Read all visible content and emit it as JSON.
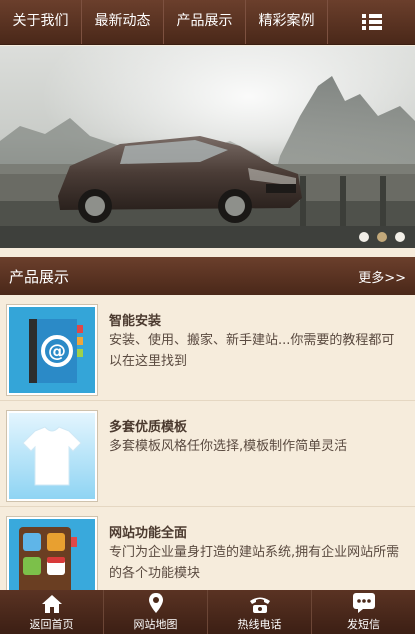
{
  "nav": {
    "items": [
      "关于我们",
      "最新动态",
      "产品展示",
      "精彩案例"
    ],
    "menu_icon": "grid-list-icon"
  },
  "banner": {
    "subject": "car-on-mountain-road",
    "dots": 3,
    "active_dot": 1
  },
  "section": {
    "title": "产品展示",
    "more": "更多>>"
  },
  "products": [
    {
      "title": "智能安装",
      "desc": "安装、使用、搬家、新手建站...你需要的教程都可以在这里找到",
      "icon": "address-book-icon"
    },
    {
      "title": "多套优质模板",
      "desc": "多套模板风格任你选择,模板制作简单灵活",
      "icon": "tshirt-icon"
    },
    {
      "title": "网站功能全面",
      "desc": "专门为企业量身打造的建站系统,拥有企业网站所需的各个功能模块",
      "icon": "app-grid-icon"
    }
  ],
  "bottom": [
    {
      "label": "返回首页",
      "icon": "home-icon"
    },
    {
      "label": "网站地图",
      "icon": "map-pin-icon"
    },
    {
      "label": "热线电话",
      "icon": "phone-icon"
    },
    {
      "label": "发短信",
      "icon": "message-icon"
    }
  ],
  "colors": {
    "bar": "#5a3323",
    "background": "#f6ecdc",
    "active_dot": "#c3a97a"
  }
}
